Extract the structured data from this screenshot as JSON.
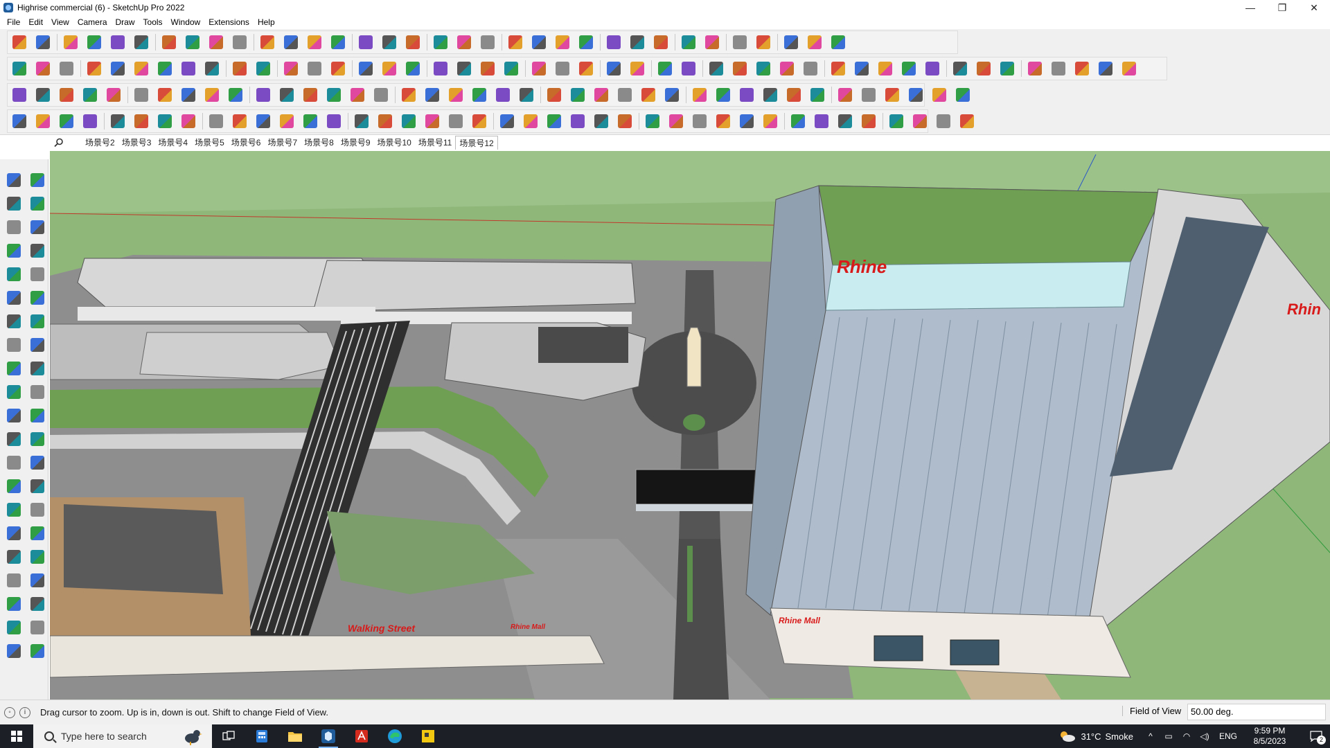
{
  "window": {
    "title": "Highrise commercial (6) - SketchUp Pro 2022",
    "controls": {
      "minimize": "—",
      "maximize": "❐",
      "close": "✕"
    }
  },
  "menu": [
    "File",
    "Edit",
    "View",
    "Camera",
    "Draw",
    "Tools",
    "Window",
    "Extensions",
    "Help"
  ],
  "scenes": {
    "search_icon": "search-icon",
    "tabs": [
      "场景号2",
      "场景号3",
      "场景号4",
      "场景号5",
      "场景号6",
      "场景号7",
      "场景号8",
      "场景号9",
      "场景号10",
      "场景号11",
      "场景号12"
    ],
    "active_tab": "场景号12"
  },
  "model": {
    "signs": {
      "tower_main": "Rhine",
      "tower_side": "Rhin",
      "mall_entrance": "Rhine Mall",
      "podium_left": "Walking Street",
      "podium_right": "Rhine Mall"
    }
  },
  "status": {
    "message": "Drag cursor to zoom.  Up is in, down is out. Shift to change Field of View.",
    "measurement_label": "Field of View",
    "measurement_value": "50.00 deg."
  },
  "taskbar": {
    "search_placeholder": "Type here to search",
    "weather": {
      "temp": "31°C",
      "condition": "Smoke"
    },
    "language": "ENG",
    "time": "9:59 PM",
    "date": "8/5/2023",
    "notifications": "2"
  },
  "colors": {
    "accent_tool": "#d84a3a",
    "sign_red": "#d81a1a",
    "grass": "#8fb77a",
    "taskbar": "#1c1f26"
  }
}
